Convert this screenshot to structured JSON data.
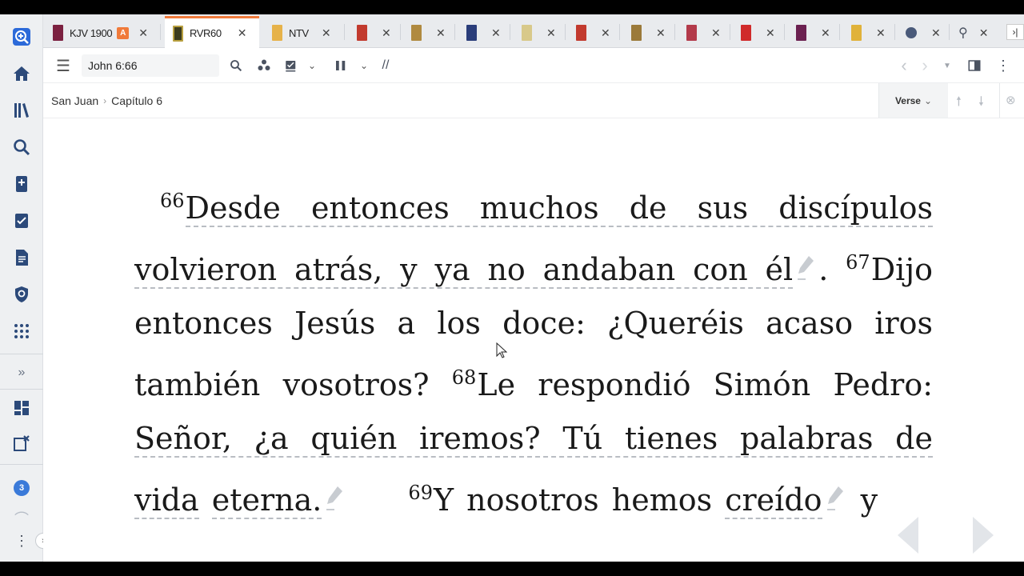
{
  "tabs": [
    {
      "label": "KJV 1900",
      "badge": "A",
      "color": "#7b2040",
      "active": false
    },
    {
      "label": "RVR60",
      "badge": "",
      "color": "#3c3c1e",
      "active": true
    },
    {
      "label": "NTV",
      "badge": "",
      "color": "#e6b24a",
      "active": false
    },
    {
      "label": "",
      "color": "#c23a2e"
    },
    {
      "label": "",
      "color": "#b08a40"
    },
    {
      "label": "",
      "color": "#2a3d7a"
    },
    {
      "label": "",
      "color": "#d8c98a"
    },
    {
      "label": "",
      "color": "#c23a2e"
    },
    {
      "label": "",
      "color": "#9b7a3a"
    },
    {
      "label": "",
      "color": "#b33a4a"
    },
    {
      "label": "",
      "color": "#d02a2a"
    },
    {
      "label": "",
      "color": "#6b2050"
    },
    {
      "label": "",
      "color": "#e0b23a"
    },
    {
      "label": "",
      "color": "#4a5a7a"
    }
  ],
  "toolbar": {
    "reference": "John 6:66",
    "parallel": "//"
  },
  "breadcrumb": {
    "book": "San Juan",
    "chapter": "Capítulo 6"
  },
  "view_mode": "Verse",
  "rail_badge": "3",
  "verses": {
    "v66_num": "66",
    "v66_a": "Desde entonces muchos de sus discípulos",
    "v66_b": "volvieron atrás, y ya no andaban con él",
    "v66_end": ".",
    "v67_num": "67",
    "v67": "Dijo entonces Jesús a los doce: ¿Queréis acaso iros también vosotros?",
    "v68_num": "68",
    "v68_a": "Le respondió Simón Pedro:",
    "v68_b": "Señor, ¿a quién iremos? Tú tienes palabras de vida",
    "v68_c": "eterna.",
    "v69_num": "69",
    "v69_a": "Y nosotros hemos",
    "v69_b": "creído",
    "v69_c": "y"
  }
}
